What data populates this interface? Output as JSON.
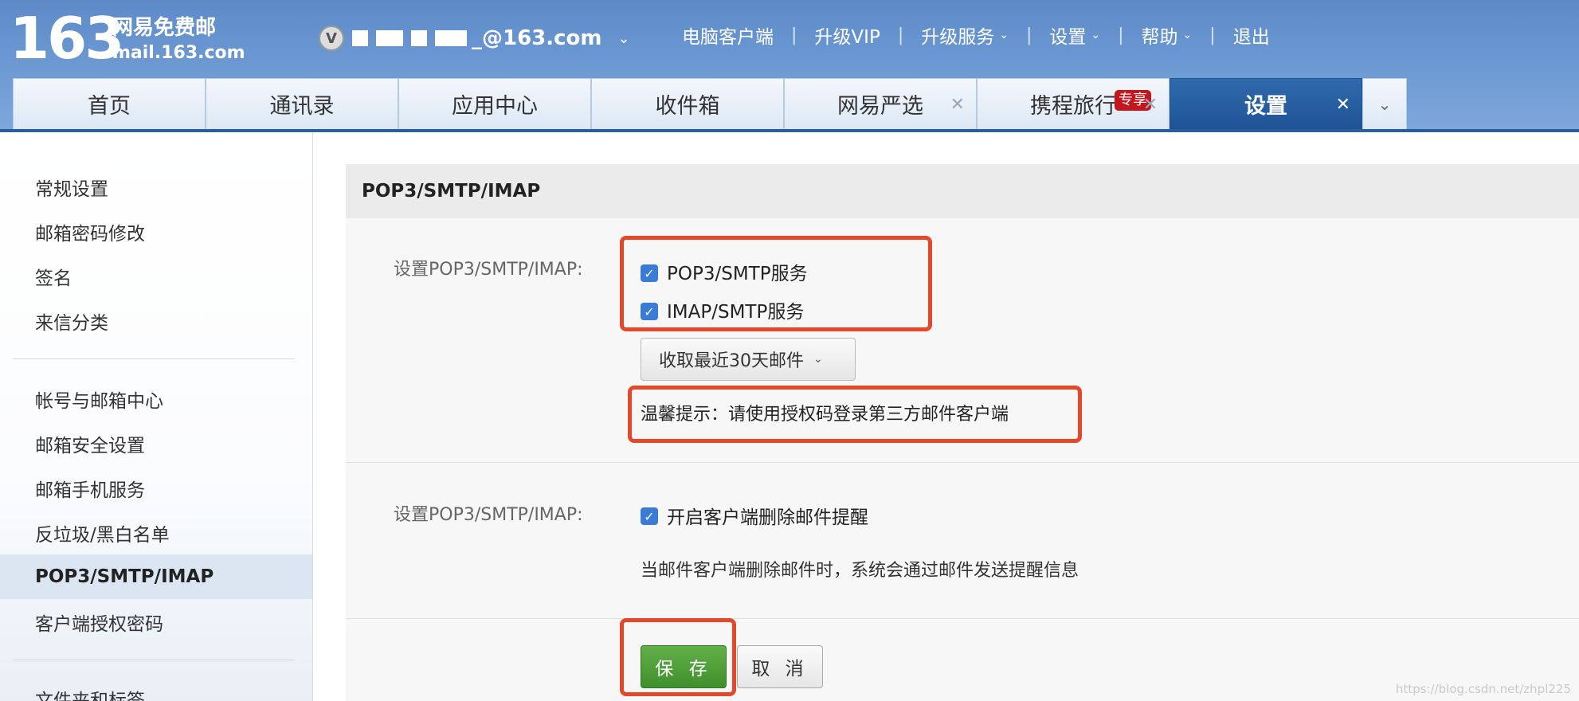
{
  "brand": {
    "logo_number": "163",
    "logo_name": "网易免费邮",
    "logo_domain": "mail.163.com"
  },
  "account": {
    "badge": "V",
    "email_suffix": "_@163.com"
  },
  "top_nav": [
    {
      "label": "电脑客户端"
    },
    {
      "label": "升级VIP"
    },
    {
      "label": "升级服务",
      "dropdown": true
    },
    {
      "label": "设置",
      "dropdown": true
    },
    {
      "label": "帮助",
      "dropdown": true
    },
    {
      "label": "退出"
    }
  ],
  "tabs": [
    {
      "label": "首页"
    },
    {
      "label": "通讯录"
    },
    {
      "label": "应用中心"
    },
    {
      "label": "收件箱"
    },
    {
      "label": "网易严选",
      "closable": true
    },
    {
      "label": "携程旅行",
      "badge": "专享",
      "closable": true
    },
    {
      "label": "设置",
      "active": true,
      "closable": true
    }
  ],
  "sidebar": {
    "items": [
      "常规设置",
      "邮箱密码修改",
      "签名",
      "来信分类",
      "帐号与邮箱中心",
      "邮箱安全设置",
      "邮箱手机服务",
      "反垃圾/黑白名单",
      "POP3/SMTP/IMAP",
      "客户端授权密码",
      "文件夹和标签"
    ],
    "active": "POP3/SMTP/IMAP"
  },
  "panel": {
    "title": "POP3/SMTP/IMAP",
    "section1": {
      "label": "设置POP3/SMTP/IMAP:",
      "options": [
        {
          "label": "POP3/SMTP服务",
          "checked": true
        },
        {
          "label": "IMAP/SMTP服务",
          "checked": true
        }
      ],
      "fetch_select": "收取最近30天邮件",
      "tip": "温馨提示：请使用授权码登录第三方邮件客户端"
    },
    "section2": {
      "label": "设置POP3/SMTP/IMAP:",
      "option": {
        "label": "开启客户端删除邮件提醒",
        "checked": true
      },
      "note": "当邮件客户端删除邮件时，系统会通过邮件发送提醒信息"
    },
    "buttons": {
      "save": "保 存",
      "cancel": "取 消"
    }
  },
  "colors": {
    "header_blue": "#6b98d2",
    "active_tab": "#1f5495",
    "highlight": "#e5472b",
    "save_green": "#4c9e36",
    "checkbox": "#3a7bd5"
  },
  "watermark": "https://blog.csdn.net/zhpl225"
}
